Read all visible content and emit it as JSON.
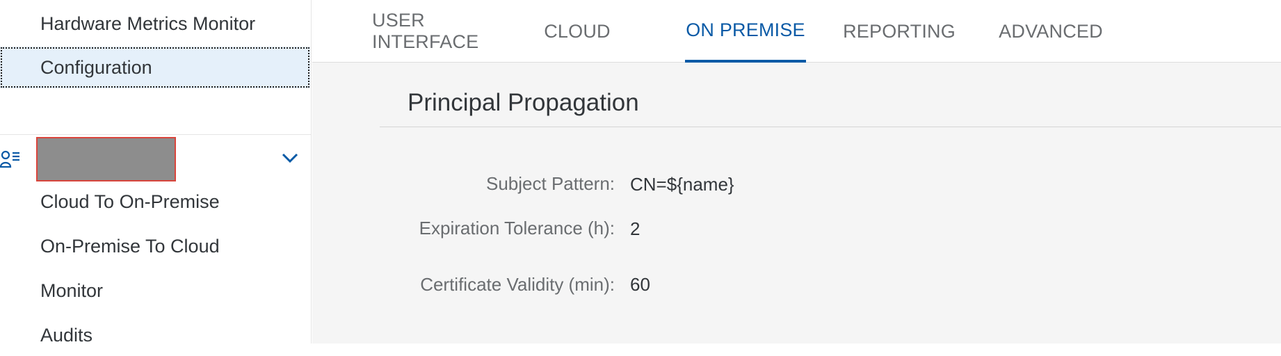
{
  "sidebar": {
    "items_top": [
      {
        "label": "Hardware Metrics Monitor"
      },
      {
        "label": "Configuration",
        "selected": true
      }
    ],
    "group": {
      "icon": "user-list-icon",
      "name_redacted": true,
      "toggle_icon": "chevron-down-icon"
    },
    "items_group": [
      {
        "label": "Cloud To On-Premise"
      },
      {
        "label": "On-Premise To Cloud"
      },
      {
        "label": "Monitor"
      },
      {
        "label": "Audits"
      }
    ]
  },
  "tabs": [
    {
      "label": "USER INTERFACE"
    },
    {
      "label": "CLOUD"
    },
    {
      "label": "ON PREMISE",
      "active": true
    },
    {
      "label": "REPORTING"
    },
    {
      "label": "ADVANCED"
    }
  ],
  "section": {
    "title": "Principal Propagation",
    "fields": [
      {
        "label": "Subject Pattern:",
        "value": "CN=${name}"
      },
      {
        "label": "Expiration Tolerance (h):",
        "value": "2"
      },
      {
        "label": "Certificate Validity (min):",
        "value": "60"
      }
    ]
  },
  "colors": {
    "accent": "#0a5aa6",
    "selected_bg": "#e5f0fa",
    "content_bg": "#f5f5f5",
    "redaction": "#8d8d8d",
    "redaction_border": "#d9453c"
  }
}
